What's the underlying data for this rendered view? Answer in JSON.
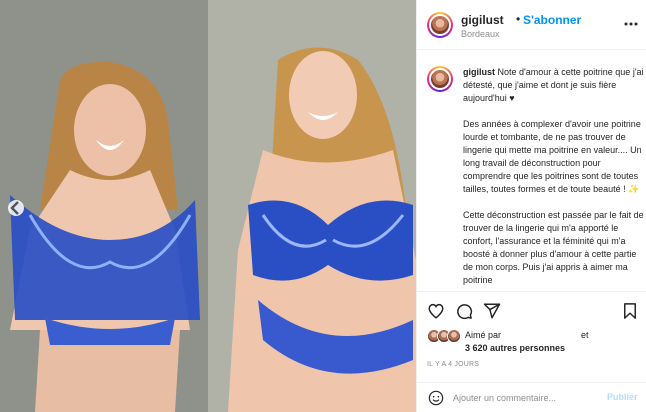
{
  "post": {
    "username": "gigilust",
    "follow_label": "S'abonner",
    "separator": "•",
    "location": "Bordeaux",
    "more_icon": "more-horizontal-icon"
  },
  "caption": {
    "username": "gigilust",
    "paragraph_1": "Note d'amour à cette poitrine que j'ai détesté, que j'aime et dont je suis fière aujourd'hui ♥",
    "paragraph_2": "Des années à complexer d'avoir une poitrine lourde et tombante, de ne pas trouver de lingerie qui mette ma poitrine en valeur.... Un long travail de déconstruction pour comprendre que les poitrines sont de toutes tailles, toutes formes et de toute beauté ! ✨",
    "paragraph_3": "Cette déconstruction est passée par le fait de trouver de la lingerie qui m'a apporté le confort, l'assurance et la féminité qui m'a boosté à donner plus d'amour à cette partie de mon corps. Puis j'ai appris à aimer ma poitrine"
  },
  "actions": {
    "like_icon": "heart-icon",
    "comment_icon": "comment-icon",
    "share_icon": "send-icon",
    "save_icon": "bookmark-icon"
  },
  "likes": {
    "liked_by": "Aimé par",
    "and": "et",
    "others": "3 620 autres personnes"
  },
  "timestamp": "IL Y A 4 JOURS",
  "comment": {
    "placeholder": "Ajouter un commentaire...",
    "publish_label": "Publier",
    "emoji_icon": "smiley-icon"
  },
  "colors": {
    "accent": "#0095f6",
    "publish_disabled": "#b2dffc",
    "lingerie": "#2a4fc4"
  }
}
